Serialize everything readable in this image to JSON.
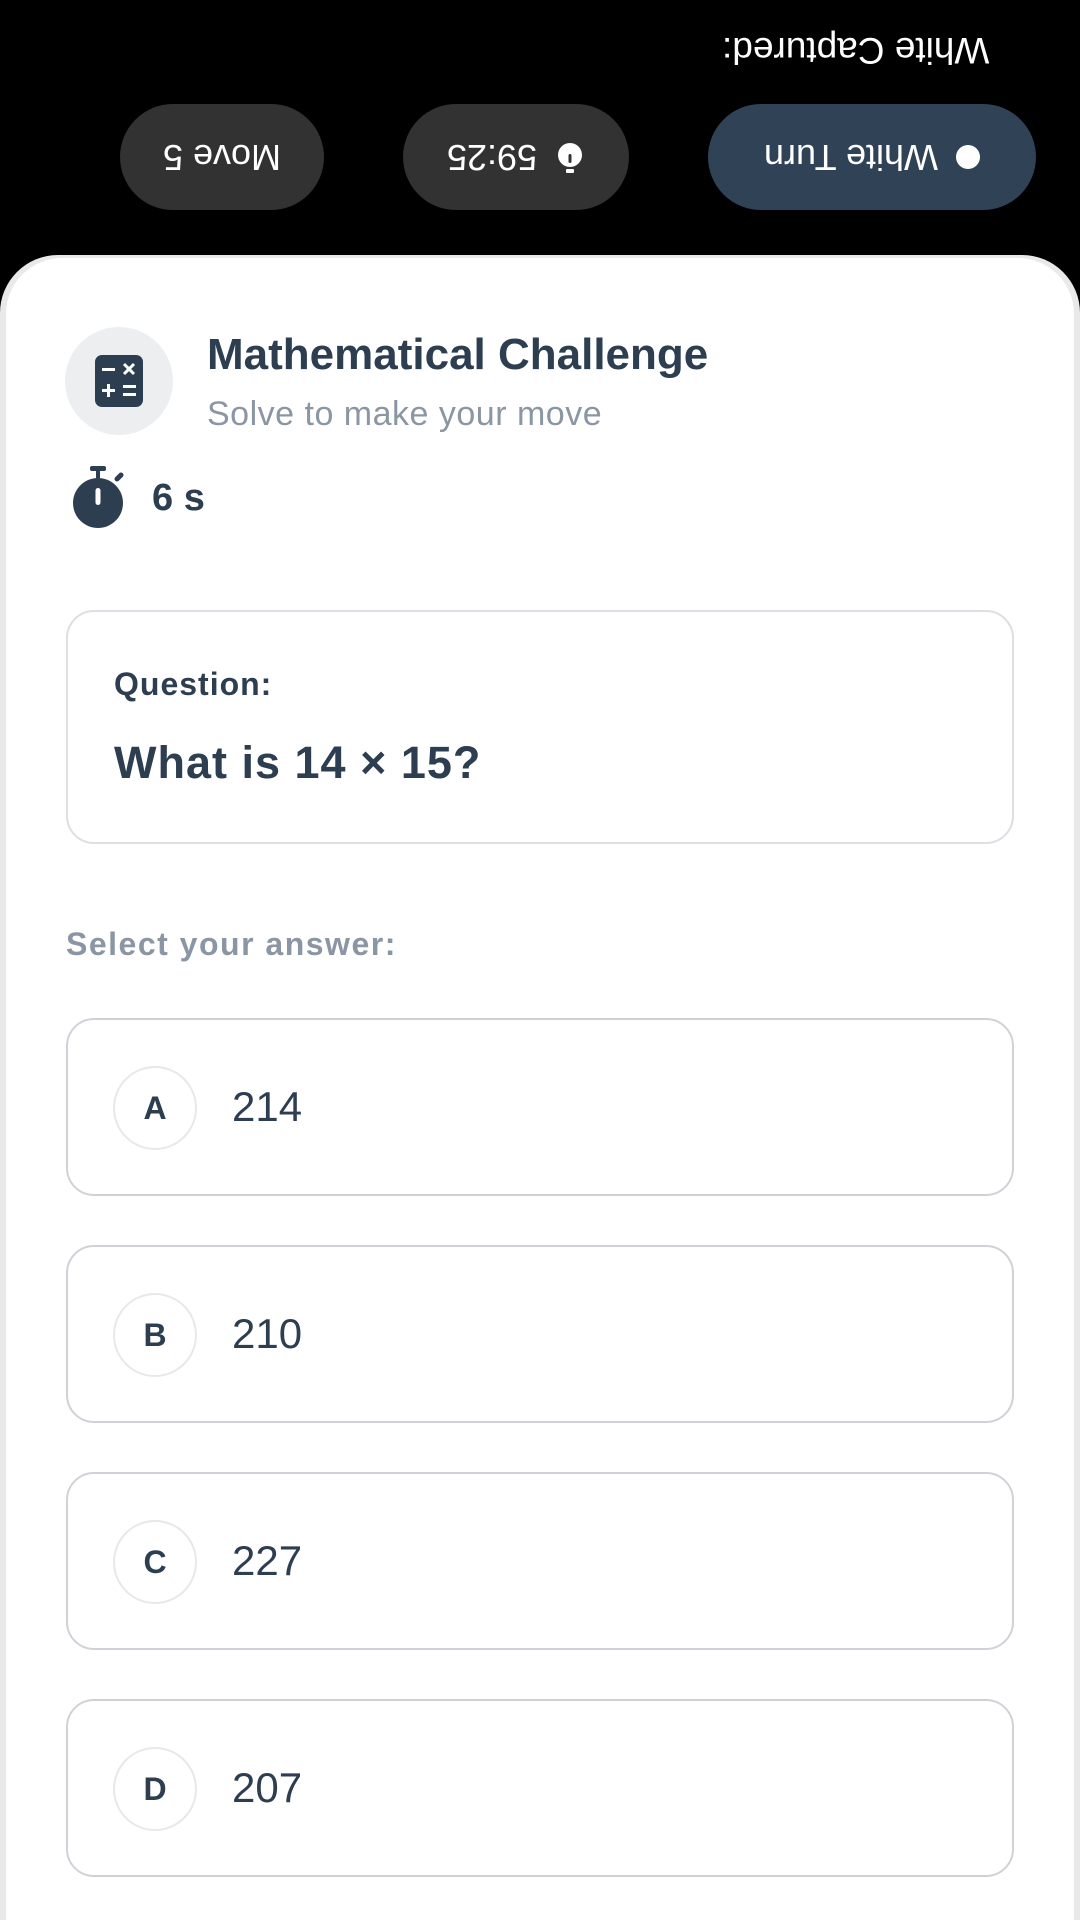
{
  "top_bar": {
    "captured_label": "White Captured:",
    "turn_label": "White Turn",
    "timer_value": "59:25",
    "move_label": "Move 5",
    "turn_color": "#2f4256"
  },
  "challenge": {
    "title": "Mathematical Challenge",
    "subtitle": "Solve to make your move",
    "icon": "calculator-icon",
    "countdown": "6 s",
    "countdown_icon": "stopwatch-icon"
  },
  "question": {
    "label": "Question:",
    "text": "What is 14 × 15?"
  },
  "answers": {
    "prompt": "Select your answer:",
    "options": [
      {
        "letter": "A",
        "value": "214"
      },
      {
        "letter": "B",
        "value": "210"
      },
      {
        "letter": "C",
        "value": "227"
      },
      {
        "letter": "D",
        "value": "207"
      }
    ]
  },
  "colors": {
    "primary_text": "#2c3e50",
    "secondary_text": "#8a96a3"
  }
}
